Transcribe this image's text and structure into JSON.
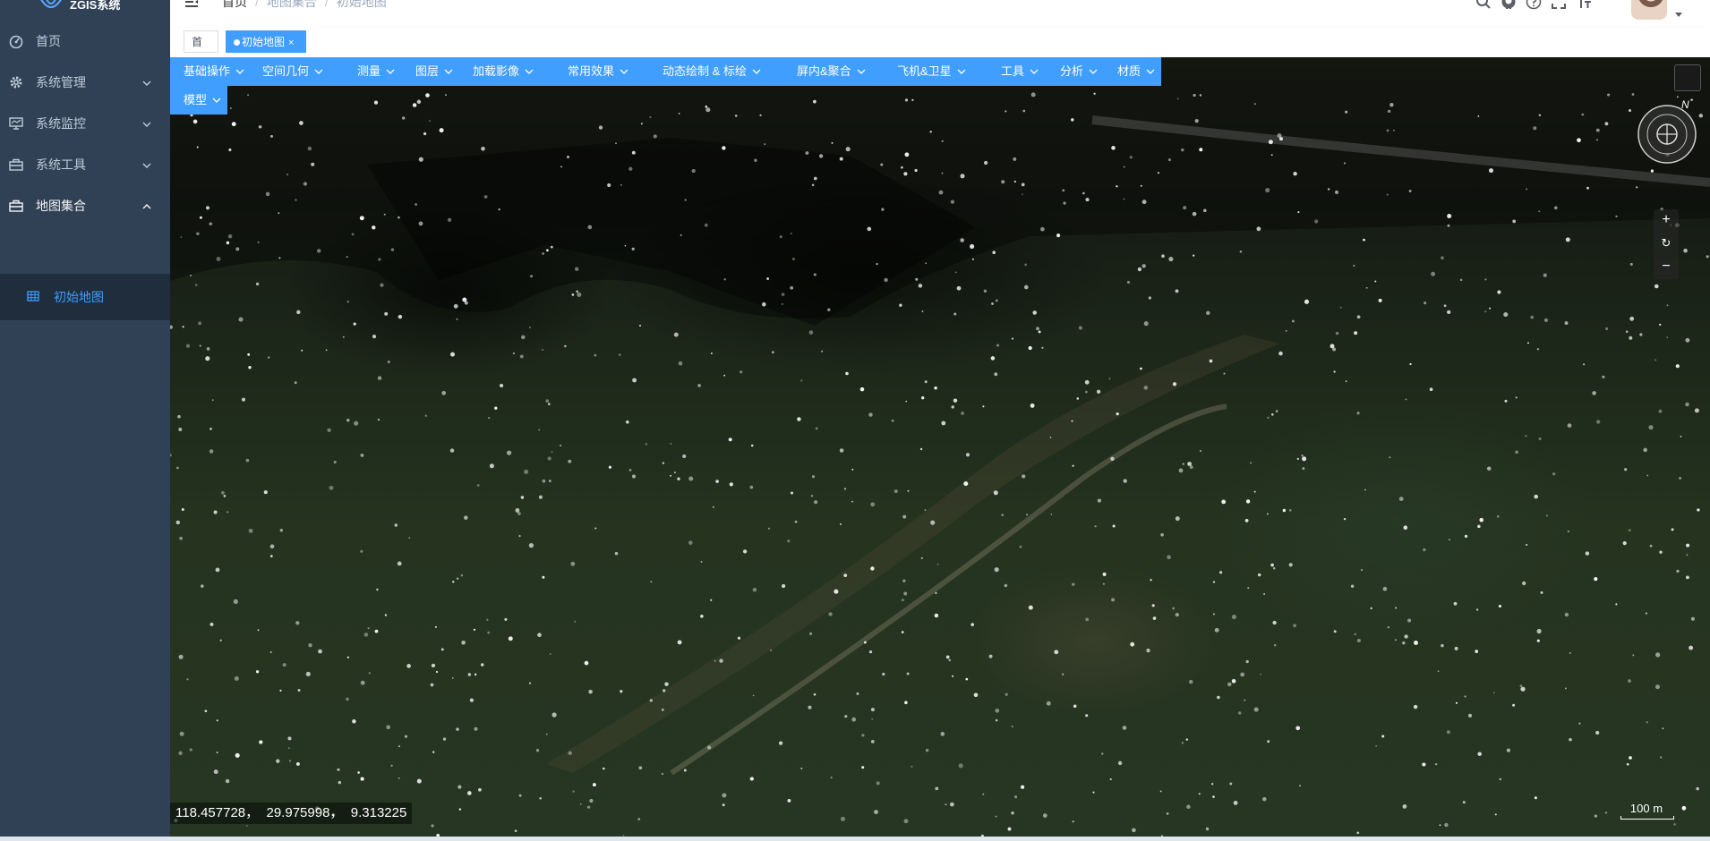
{
  "app": {
    "title": "ZGIS系统"
  },
  "sidebar": {
    "items": [
      {
        "label": "首页",
        "icon": "dashboard-icon"
      },
      {
        "label": "系统管理",
        "icon": "gear-icon"
      },
      {
        "label": "系统监控",
        "icon": "monitor-icon"
      },
      {
        "label": "系统工具",
        "icon": "toolbox-icon"
      },
      {
        "label": "地图集合",
        "icon": "toolbox-icon"
      }
    ],
    "submenu": {
      "label": "初始地图",
      "icon": "table-icon"
    }
  },
  "breadcrumb": [
    "首页",
    "地图集合",
    "初始地图"
  ],
  "tags": {
    "home": "首页",
    "active": "初始地图",
    "close": "×"
  },
  "toolbar": {
    "menus": [
      "基础操作",
      "空间几何",
      "测量",
      "图层",
      "加载影像",
      "常用效果",
      "动态绘制 & 标绘",
      "屏内&聚合",
      "飞机&卫星",
      "工具",
      "分析",
      "材质",
      "模型"
    ]
  },
  "map": {
    "compass_north": "N",
    "zoom_in": "+",
    "reset": "↻",
    "zoom_out": "−",
    "coordinates": {
      "lon": "118.457728",
      "lat": "29.975998",
      "height": "9.313225",
      "separator": "，"
    },
    "scale_label": "100 m"
  },
  "colors": {
    "sidebar_bg": "#304156",
    "active": "#409eff",
    "sidebar_text": "#bfcbd9"
  }
}
